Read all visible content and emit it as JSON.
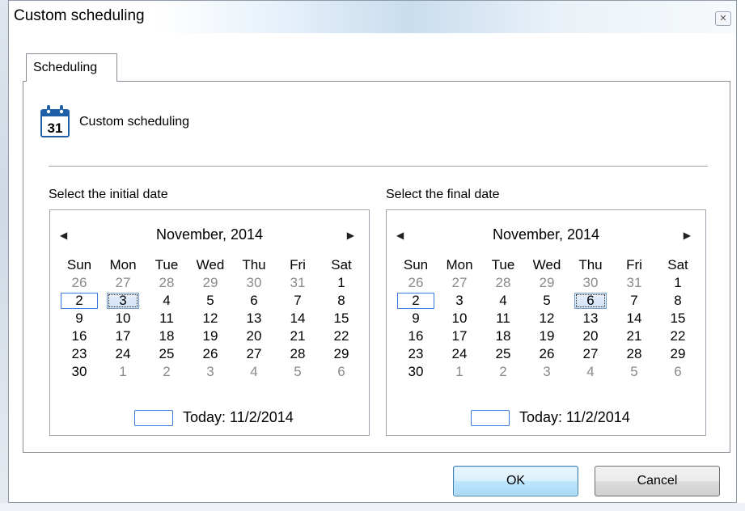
{
  "window": {
    "title": "Custom scheduling"
  },
  "tabs": [
    {
      "label": "Scheduling"
    }
  ],
  "header": {
    "icon": "calendar-icon",
    "icon_number": "31",
    "label": "Custom scheduling"
  },
  "initial_calendar": {
    "title": "Select the initial date",
    "month": "November, 2014",
    "day_names": [
      "Sun",
      "Mon",
      "Tue",
      "Wed",
      "Thu",
      "Fri",
      "Sat"
    ],
    "weeks": [
      [
        "26",
        "27",
        "28",
        "29",
        "30",
        "31",
        "1"
      ],
      [
        "2",
        "3",
        "4",
        "5",
        "6",
        "7",
        "8"
      ],
      [
        "9",
        "10",
        "11",
        "12",
        "13",
        "14",
        "15"
      ],
      [
        "16",
        "17",
        "18",
        "19",
        "20",
        "21",
        "22"
      ],
      [
        "23",
        "24",
        "25",
        "26",
        "27",
        "28",
        "29"
      ],
      [
        "30",
        "1",
        "2",
        "3",
        "4",
        "5",
        "6"
      ]
    ],
    "today_label": "Today: 11/2/2014"
  },
  "final_calendar": {
    "title": "Select the final date",
    "month": "November, 2014",
    "day_names": [
      "Sun",
      "Mon",
      "Tue",
      "Wed",
      "Thu",
      "Fri",
      "Sat"
    ],
    "weeks": [
      [
        "26",
        "27",
        "28",
        "29",
        "30",
        "31",
        "1"
      ],
      [
        "2",
        "3",
        "4",
        "5",
        "6",
        "7",
        "8"
      ],
      [
        "9",
        "10",
        "11",
        "12",
        "13",
        "14",
        "15"
      ],
      [
        "16",
        "17",
        "18",
        "19",
        "20",
        "21",
        "22"
      ],
      [
        "23",
        "24",
        "25",
        "26",
        "27",
        "28",
        "29"
      ],
      [
        "30",
        "1",
        "2",
        "3",
        "4",
        "5",
        "6"
      ]
    ],
    "today_label": "Today: 11/2/2014"
  },
  "buttons": {
    "ok": "OK",
    "cancel": "Cancel"
  },
  "colors": {
    "selection_border": "#3879d9",
    "dim_text": "#8a8a8a",
    "ok_button": "#bee6fd"
  }
}
